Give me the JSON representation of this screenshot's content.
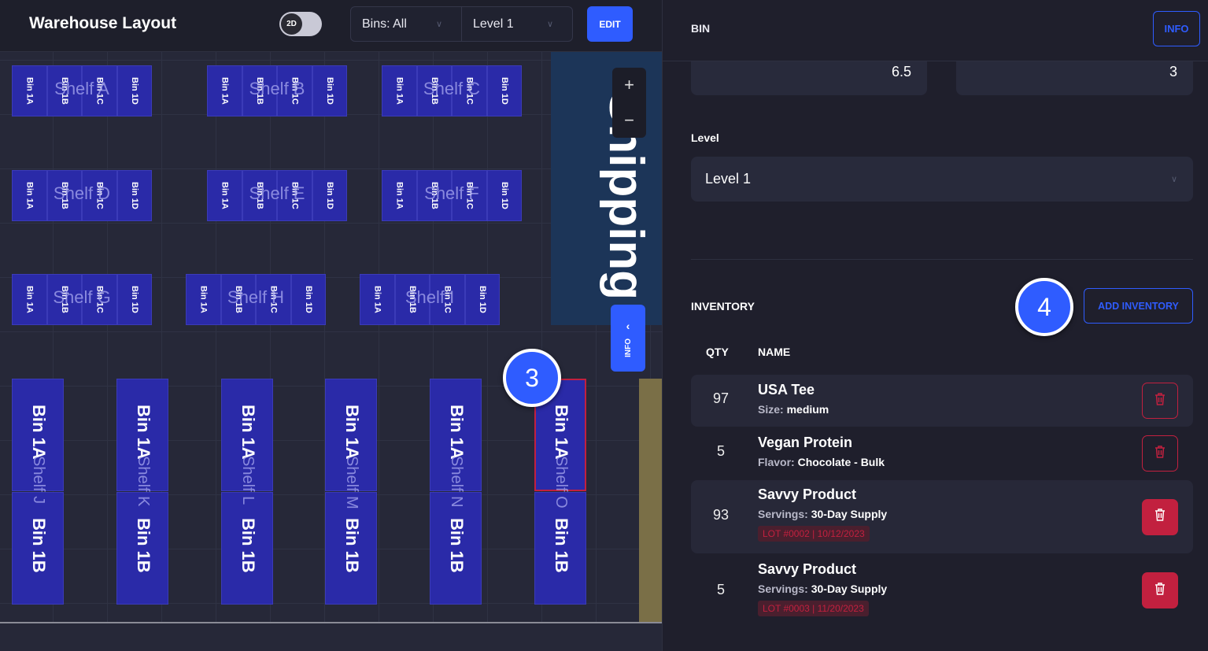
{
  "header": {
    "title": "Warehouse Layout",
    "view_toggle": "2D",
    "bins_filter": "Bins: All",
    "level_filter": "Level 1",
    "edit_label": "EDIT"
  },
  "map": {
    "shelves": [
      {
        "name": "Shelf A",
        "bins": [
          "Bin 1A",
          "Bin 1B",
          "Bin 1C",
          "Bin 1D"
        ]
      },
      {
        "name": "Shelf B",
        "bins": [
          "Bin 1A",
          "Bin 1B",
          "Bin 1C",
          "Bin 1D"
        ]
      },
      {
        "name": "Shelf C",
        "bins": [
          "Bin 1A",
          "Bin 1B",
          "Bin 1C",
          "Bin 1D"
        ]
      },
      {
        "name": "Shelf D",
        "bins": [
          "Bin 1A",
          "Bin 1B",
          "Bin 1C",
          "Bin 1D"
        ]
      },
      {
        "name": "Shelf E",
        "bins": [
          "Bin 1A",
          "Bin 1B",
          "Bin 1C",
          "Bin 1D"
        ]
      },
      {
        "name": "Shelf F",
        "bins": [
          "Bin 1A",
          "Bin 1B",
          "Bin 1C",
          "Bin 1D"
        ]
      },
      {
        "name": "Shelf G",
        "bins": [
          "Bin 1A",
          "Bin 1B",
          "Bin 1C",
          "Bin 1D"
        ]
      },
      {
        "name": "Shelf H",
        "bins": [
          "Bin 1A",
          "Bin 1B",
          "Bin 1C",
          "Bin 1D"
        ]
      },
      {
        "name": "Shelf I",
        "bins": [
          "Bin 1A",
          "Bin 1B",
          "Bin 1C",
          "Bin 1D"
        ]
      }
    ],
    "vertical_shelves": [
      {
        "name": "Shelf J",
        "bins": [
          "Bin 1A",
          "Bin 1B"
        ]
      },
      {
        "name": "Shelf K",
        "bins": [
          "Bin 1A",
          "Bin 1B"
        ]
      },
      {
        "name": "Shelf L",
        "bins": [
          "Bin 1A",
          "Bin 1B"
        ]
      },
      {
        "name": "Shelf M",
        "bins": [
          "Bin 1A",
          "Bin 1B"
        ]
      },
      {
        "name": "Shelf N",
        "bins": [
          "Bin 1A",
          "Bin 1B"
        ]
      },
      {
        "name": "Shelf O",
        "bins": [
          "Bin 1A",
          "Bin 1B"
        ],
        "selected_bin": 0
      }
    ],
    "zone_label": "Shipping",
    "zoom_in": "+",
    "zoom_out": "−",
    "info_tab": "INFO",
    "markers": [
      "3",
      "4"
    ],
    "colors": {
      "bin": "#2a2aa8",
      "selected": "#c2203f",
      "shipping": "#1c3558",
      "accent": "#2f5cff"
    }
  },
  "panel": {
    "title": "BIN",
    "info_label": "INFO",
    "field1_value": "6.5",
    "field2_value": "3",
    "level_label": "Level",
    "level_value": "Level 1",
    "inventory_title": "INVENTORY",
    "add_inventory_label": "ADD INVENTORY",
    "col_qty": "QTY",
    "col_name": "NAME",
    "items": [
      {
        "qty": "97",
        "name": "USA Tee",
        "attr_key": "Size:",
        "attr_value": "medium"
      },
      {
        "qty": "5",
        "name": "Vegan Protein",
        "attr_key": "Flavor:",
        "attr_value": "Chocolate - Bulk"
      },
      {
        "qty": "93",
        "name": "Savvy Product",
        "attr_key": "Servings:",
        "attr_value": "30-Day Supply",
        "lot": "LOT #0002 | 10/12/2023"
      },
      {
        "qty": "5",
        "name": "Savvy Product",
        "attr_key": "Servings:",
        "attr_value": "30-Day Supply",
        "lot": "LOT #0003 | 11/20/2023"
      }
    ]
  }
}
